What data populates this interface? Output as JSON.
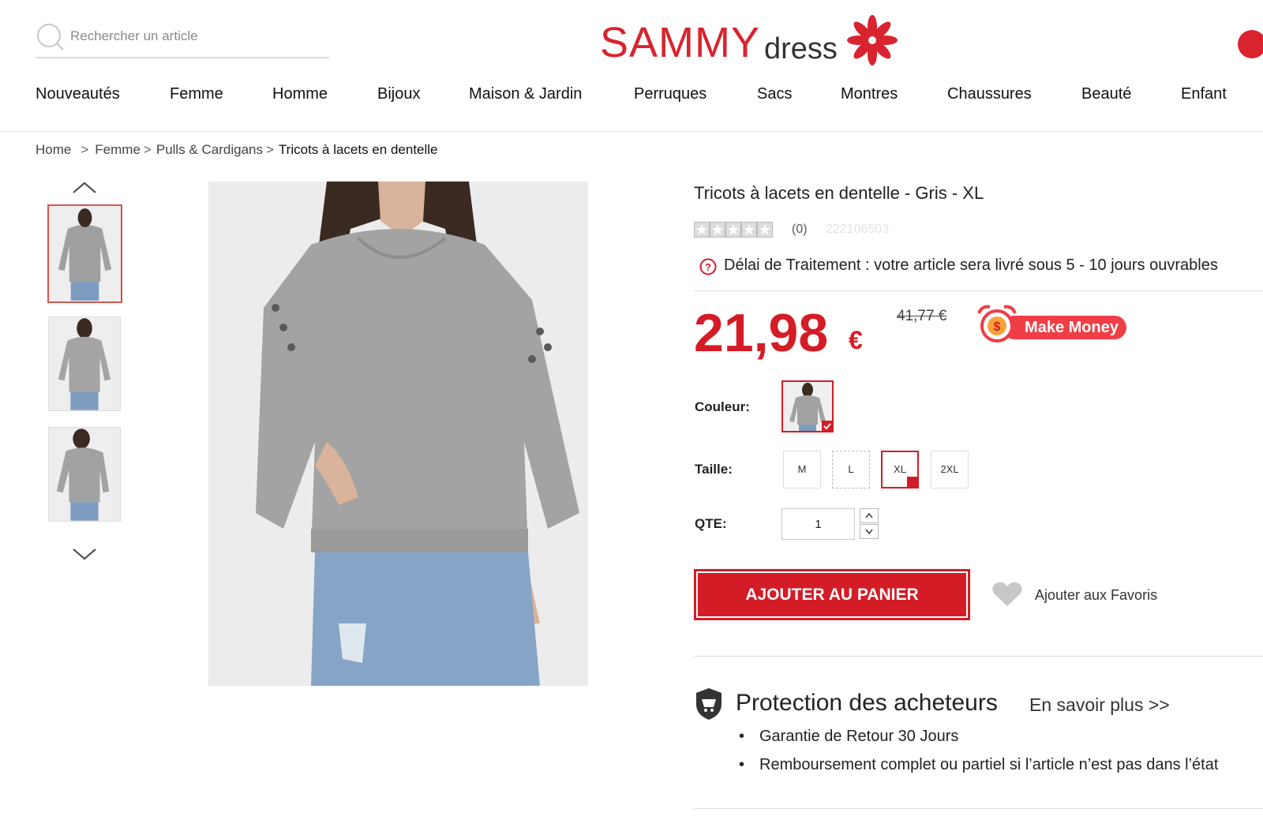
{
  "search": {
    "placeholder": "Rechercher un article"
  },
  "brand": {
    "name_part1": "SAMMY",
    "name_part2": "dress",
    "color": "#d9232e"
  },
  "nav": {
    "items": [
      "Nouveautés",
      "Femme",
      "Homme",
      "Bijoux",
      "Maison & Jardin",
      "Perruques",
      "Sacs",
      "Montres",
      "Chaussures",
      "Beauté",
      "Enfant"
    ]
  },
  "breadcrumb": {
    "home": "Home",
    "level1": "Femme",
    "level2": "Pulls & Cardigans",
    "current": "Tricots à lacets en dentelle",
    "sep": ">"
  },
  "product": {
    "title": "Tricots à lacets en dentelle - Gris - XL",
    "rating_stars": 0,
    "review_count": "(0)",
    "sku": "222106503",
    "delay_text": "Délai de Traitement : votre article sera livré sous 5 - 10 jours ouvrables",
    "price": "21,98",
    "currency": "€",
    "old_price": "41,77 €",
    "make_money": "Make Money",
    "accent_color": "#d41c26"
  },
  "options": {
    "color_label": "Couleur:",
    "size_label": "Taille:",
    "sizes": [
      "M",
      "L",
      "XL",
      "2XL"
    ],
    "selected_size": "XL",
    "qty_label": "QTE:",
    "qty_value": "1"
  },
  "actions": {
    "add_to_cart": "AJOUTER AU PANIER",
    "add_to_favorites": "Ajouter aux Favoris"
  },
  "protection": {
    "title": "Protection des acheteurs",
    "learn_more": "En savoir plus >>",
    "bullets": [
      "Garantie de Retour 30 Jours",
      "Remboursement complet ou partiel si l’article n’est pas dans l’état"
    ]
  },
  "icons": [
    "search-icon",
    "flower-logo-icon",
    "chevron-up-icon",
    "chevron-down-icon",
    "question-icon",
    "alarm-clock-icon",
    "heart-icon",
    "shield-cart-icon",
    "check-icon"
  ]
}
